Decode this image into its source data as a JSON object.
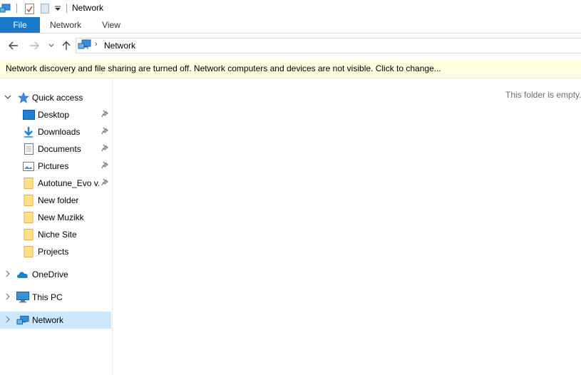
{
  "window": {
    "title": "Network"
  },
  "ribbon": {
    "tabs": [
      "File",
      "Network",
      "View"
    ]
  },
  "address": {
    "segment": "Network",
    "separator": "›"
  },
  "info_bar": {
    "text": "Network discovery and file sharing are turned off. Network computers and devices are not visible. Click to change..."
  },
  "nav": {
    "quick_access": "Quick access",
    "items": [
      {
        "label": "Desktop",
        "icon": "desktop-icon",
        "pinned": true
      },
      {
        "label": "Downloads",
        "icon": "download-arrow-icon",
        "pinned": true
      },
      {
        "label": "Documents",
        "icon": "document-icon",
        "pinned": true
      },
      {
        "label": "Pictures",
        "icon": "picture-icon",
        "pinned": true
      },
      {
        "label": "Autotune_Evo v.",
        "icon": "folder-icon",
        "pinned": true
      },
      {
        "label": "New folder",
        "icon": "folder-icon",
        "pinned": false
      },
      {
        "label": "New Muzikk",
        "icon": "folder-icon",
        "pinned": false
      },
      {
        "label": "Niche Site",
        "icon": "folder-icon",
        "pinned": false
      },
      {
        "label": "Projects",
        "icon": "folder-icon",
        "pinned": false
      }
    ],
    "onedrive": "OneDrive",
    "this_pc": "This PC",
    "network": "Network"
  },
  "content": {
    "empty_message": "This folder is empty."
  },
  "colors": {
    "accent": "#1979ca",
    "selected": "#cce8ff",
    "info_bar": "#ffffe1",
    "folder": "#ffe08a"
  }
}
